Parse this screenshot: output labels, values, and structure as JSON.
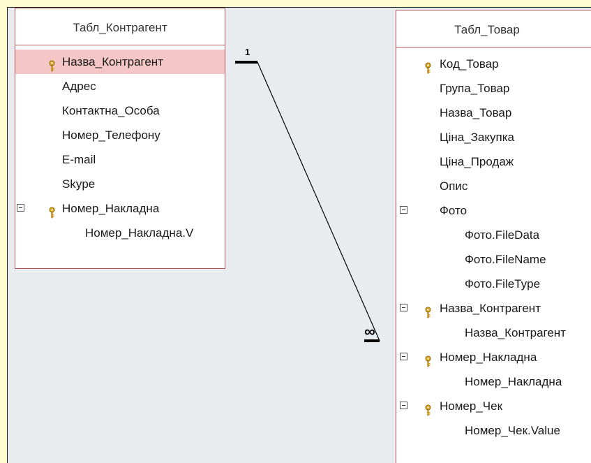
{
  "tables": {
    "left": {
      "title": "Табл_Контрагент",
      "fields": [
        {
          "label": "Назва_Контрагент",
          "key": true,
          "selected": true
        },
        {
          "label": "Адрес"
        },
        {
          "label": "Контактна_Особа"
        },
        {
          "label": "Номер_Телефону"
        },
        {
          "label": "E-mail"
        },
        {
          "label": "Skype"
        },
        {
          "label": "Номер_Накладна",
          "key": true,
          "expandable": true
        },
        {
          "label": "Номер_Накладна.V",
          "child": true
        }
      ]
    },
    "right": {
      "title": "Табл_Товар",
      "fields": [
        {
          "label": "Код_Товар",
          "key": true
        },
        {
          "label": "Група_Товар"
        },
        {
          "label": "Назва_Товар"
        },
        {
          "label": "Ціна_Закупка"
        },
        {
          "label": "Ціна_Продаж"
        },
        {
          "label": "Опис"
        },
        {
          "label": "Фото",
          "expandable": true
        },
        {
          "label": "Фото.FileData",
          "child": true
        },
        {
          "label": "Фото.FileName",
          "child": true
        },
        {
          "label": "Фото.FileType",
          "child": true
        },
        {
          "label": "Назва_Контрагент",
          "key": true,
          "expandable": true
        },
        {
          "label": "Назва_Контрагент",
          "child": true
        },
        {
          "label": "Номер_Накладна",
          "key": true,
          "expandable": true
        },
        {
          "label": "Номер_Накладна",
          "child": true
        },
        {
          "label": "Номер_Чек",
          "key": true,
          "expandable": true
        },
        {
          "label": "Номер_Чек.Value",
          "child": true
        }
      ]
    }
  },
  "relationship": {
    "one_label": "1",
    "many_label": "∞"
  },
  "colors": {
    "table_border": "#b0555a",
    "selected_row": "#f4c6c6",
    "key_icon": "#d9a21b",
    "canvas": "#e9ecef",
    "slide_bg": "#fffdd0"
  }
}
